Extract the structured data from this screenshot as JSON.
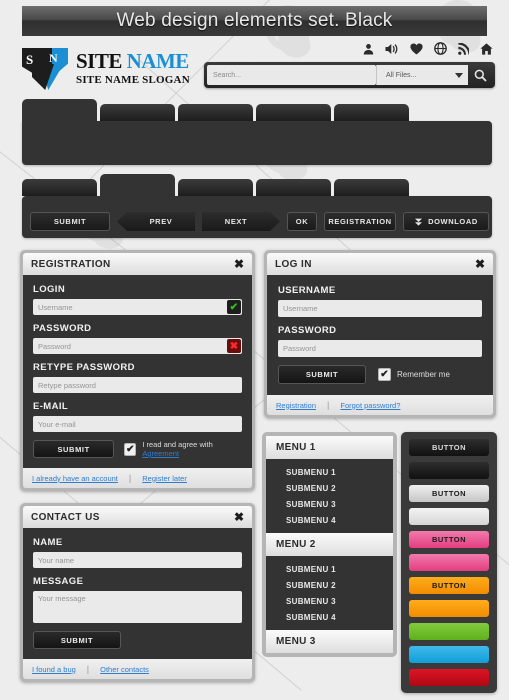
{
  "banner": {
    "title": "Web design elements set. Black"
  },
  "header": {
    "logo": {
      "mark_letter_1": "S",
      "mark_letter_2": "N",
      "title_part1": "SITE",
      "title_part2": "NAME",
      "slogan": "SITE NAME SLOGAN"
    },
    "icons": [
      "user-icon",
      "speaker-icon",
      "heart-icon",
      "globe-icon",
      "rss-icon",
      "home-icon"
    ],
    "search": {
      "placeholder": "Search...",
      "filter_value": "All Files...",
      "button": "search-icon"
    }
  },
  "tabs_row_1": {
    "active_index": 0,
    "count": 5
  },
  "tabs_row_2": {
    "active_index": 1,
    "count": 5
  },
  "buttons": [
    {
      "label": "SUBMIT",
      "shape": "rect"
    },
    {
      "label": "PREV",
      "shape": "arrow-left"
    },
    {
      "label": "NEXT",
      "shape": "arrow-right"
    },
    {
      "label": "OK",
      "shape": "rect"
    },
    {
      "label": "REGISTRATION",
      "shape": "rect"
    },
    {
      "label": "DOWNLOAD",
      "shape": "rect",
      "icon": "download-icon"
    }
  ],
  "registration": {
    "title": "REGISTRATION",
    "close": "✖",
    "fields": [
      {
        "label": "LOGIN",
        "placeholder": "Username",
        "badge": "valid",
        "badge_glyph": "✔"
      },
      {
        "label": "PASSWORD",
        "placeholder": "Password",
        "badge": "invalid",
        "badge_glyph": "✖"
      },
      {
        "label": "RETYPE PASSWORD",
        "placeholder": "Retype password",
        "badge": "none"
      },
      {
        "label": "E-MAIL",
        "placeholder": "Your e-mail",
        "badge": "none"
      }
    ],
    "submit": "SUBMIT",
    "checkbox": {
      "checked": true,
      "glyph": "✔",
      "text": "I read and agree with ",
      "link": "Agreement"
    },
    "footer": {
      "link1": "I already have an account",
      "link2": "Register later"
    }
  },
  "login": {
    "title": "LOG IN",
    "close": "✖",
    "fields": [
      {
        "label": "USERNAME",
        "placeholder": "Username"
      },
      {
        "label": "PASSWORD",
        "placeholder": "Password"
      }
    ],
    "submit": "SUBMIT",
    "checkbox": {
      "checked": true,
      "glyph": "✔",
      "text": "Remember me"
    },
    "footer": {
      "link1": "Registration",
      "link2": "Forgot password?"
    }
  },
  "contact": {
    "title": "CONTACT US",
    "close": "✖",
    "fields": [
      {
        "label": "NAME",
        "placeholder": "Your name"
      },
      {
        "label": "MESSAGE",
        "placeholder": "Your message"
      }
    ],
    "submit": "SUBMIT",
    "footer": {
      "link1": "I found a bug",
      "link2": "Other contacts"
    }
  },
  "menu": {
    "groups": [
      {
        "header": "MENU 1",
        "items": [
          "SUBMENU 1",
          "SUBMENU 2",
          "SUBMENU 3",
          "SUBMENU 4"
        ]
      },
      {
        "header": "MENU 2",
        "items": [
          "SUBMENU 1",
          "SUBMENU 2",
          "SUBMENU 3",
          "SUBMENU 4"
        ]
      },
      {
        "header": "MENU 3",
        "items": []
      }
    ]
  },
  "color_buttons": [
    {
      "label": "BUTTON",
      "color": "#1d1d1d",
      "text_color": "#dcdcdc"
    },
    {
      "label": "",
      "color": "#1d1d1d",
      "text_color": "#dcdcdc"
    },
    {
      "label": "BUTTON",
      "color": "#d8d8d8",
      "text_color": "#1a1a1a"
    },
    {
      "label": "",
      "color": "#e2e2e2",
      "text_color": "#1a1a1a"
    },
    {
      "label": "BUTTON",
      "color": "#ec5a94",
      "text_color": "#1a1a1a"
    },
    {
      "label": "",
      "color": "#ec5a94",
      "text_color": "#1a1a1a"
    },
    {
      "label": "BUTTON",
      "color": "#f59b00",
      "text_color": "#1a1a1a"
    },
    {
      "label": "",
      "color": "#f59b00",
      "text_color": "#1a1a1a"
    },
    {
      "label": "",
      "color": "#6dbe2a",
      "text_color": "#1a1a1a"
    },
    {
      "label": "",
      "color": "#29abe2",
      "text_color": "#1a1a1a"
    },
    {
      "label": "",
      "color": "#cc0d1e",
      "text_color": "#ffffff"
    }
  ]
}
